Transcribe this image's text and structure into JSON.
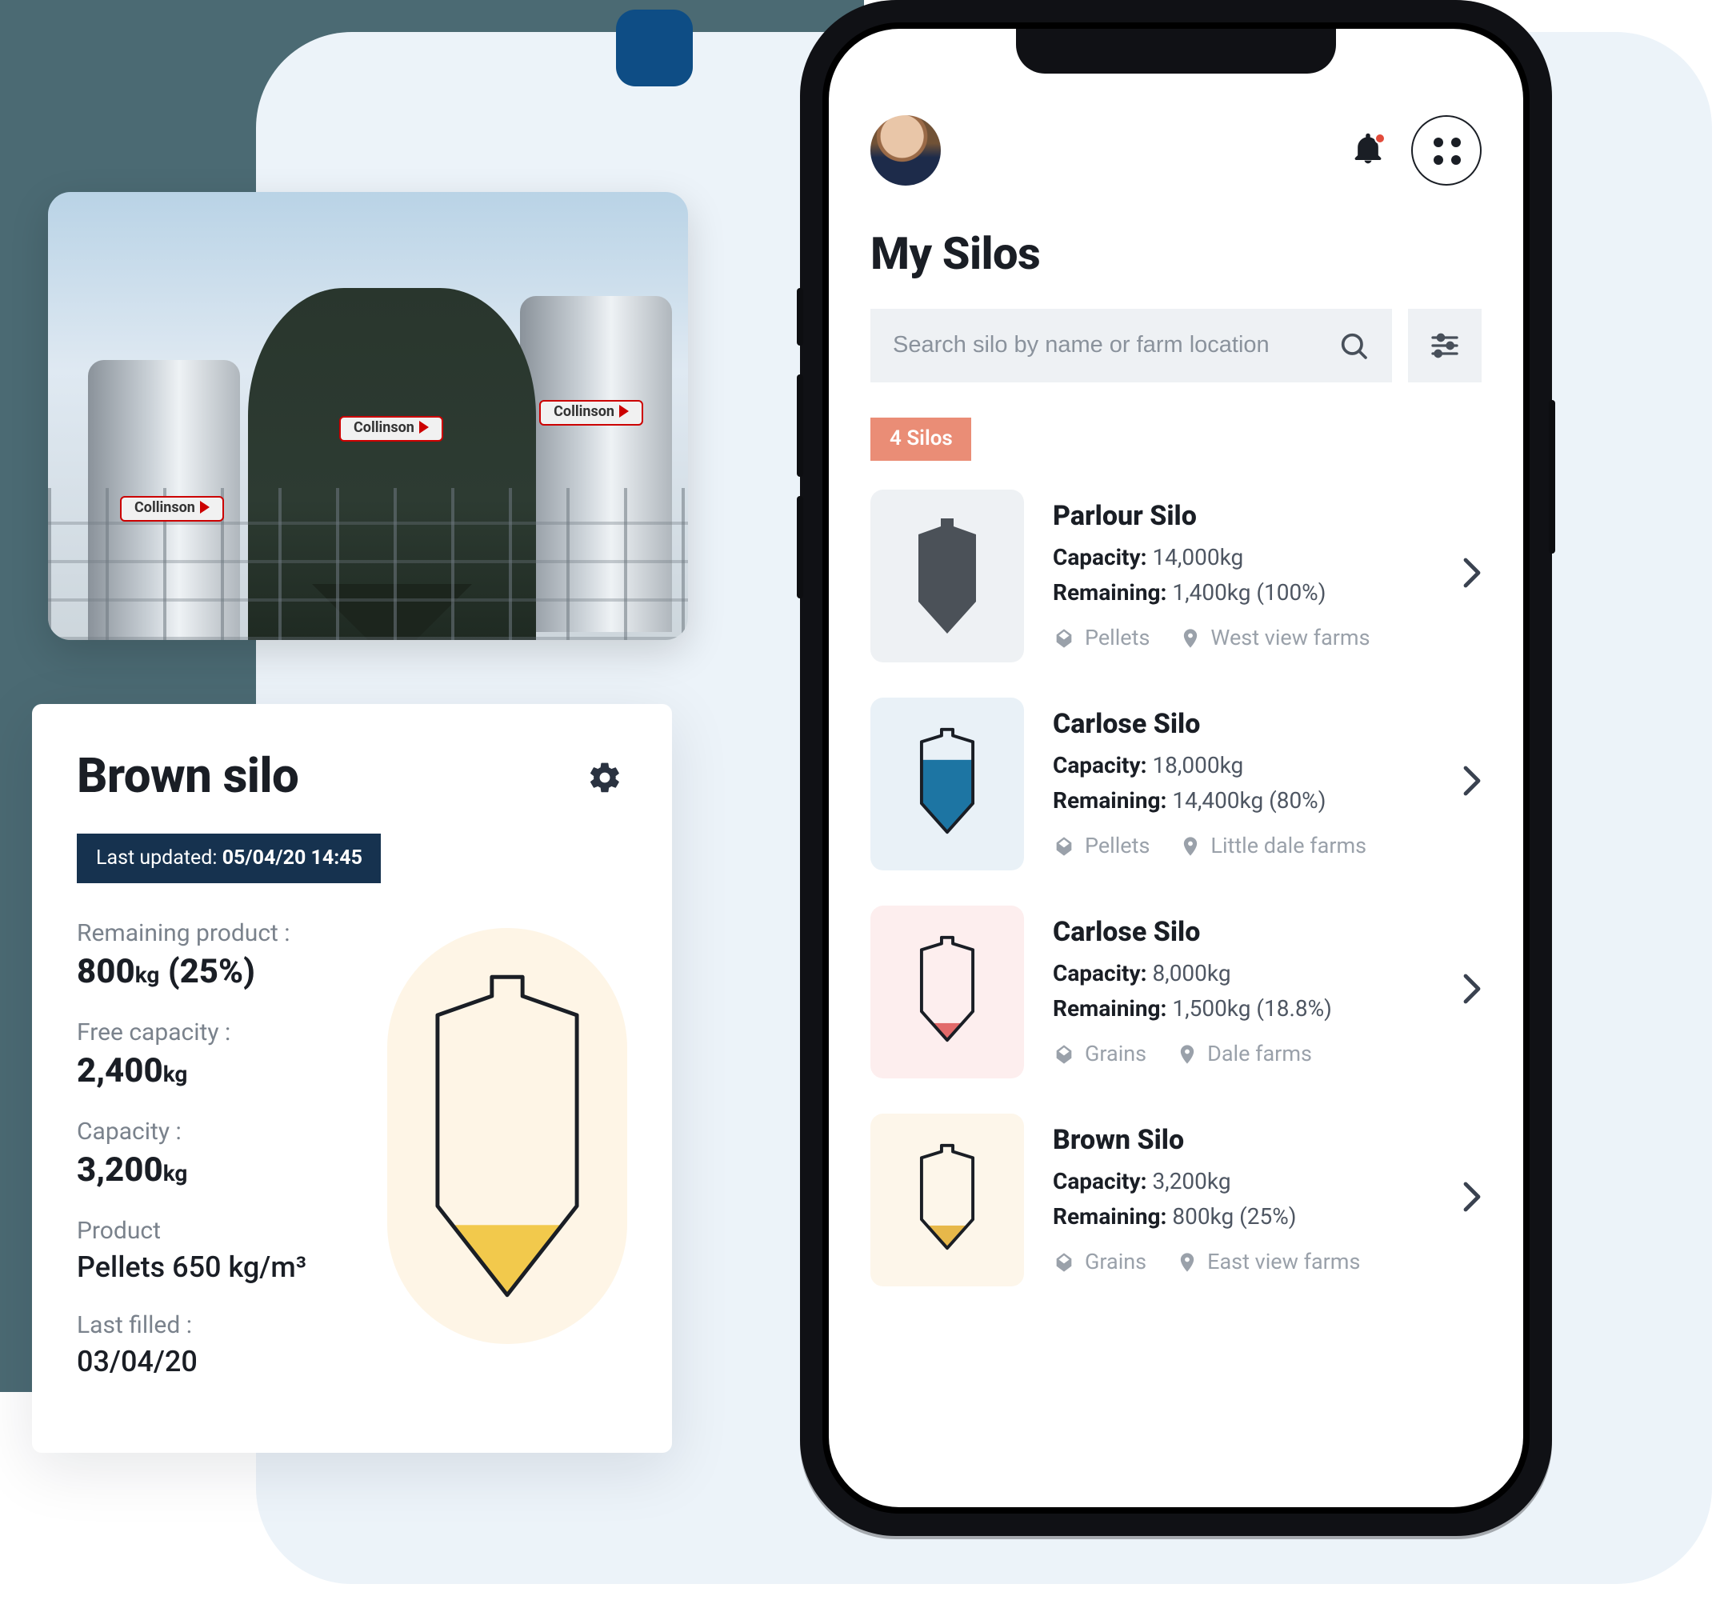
{
  "photo": {
    "brand_label": "Collinson"
  },
  "detail": {
    "title": "Brown silo",
    "last_updated_label": "Last updated:",
    "last_updated_value": "05/04/20 14:45",
    "kv": {
      "remaining_label": "Remaining product :",
      "remaining_value": "800",
      "remaining_unit": "kg",
      "remaining_pct": "(25%)",
      "free_label": "Free capacity :",
      "free_value": "2,400",
      "free_unit": "kg",
      "capacity_label": "Capacity :",
      "capacity_value": "3,200",
      "capacity_unit": "kg",
      "product_label": "Product",
      "product_value": "Pellets 650 kg/m³",
      "last_filled_label": "Last filled :",
      "last_filled_value": "03/04/20"
    },
    "fill": {
      "pct": 25,
      "color_top": "#f2c94c",
      "color_bottom": "#e0a93c"
    }
  },
  "phone": {
    "page_title": "My Silos",
    "search_placeholder": "Search silo by name or farm location",
    "count_badge": "4 Silos",
    "labels": {
      "capacity": "Capacity:",
      "remaining": "Remaining:"
    },
    "silos": [
      {
        "name": "Parlour Silo",
        "capacity": "14,000kg",
        "remaining": "1,400kg (100%)",
        "product": "Pellets",
        "location": "West view farms",
        "thumb_variant": "parlour",
        "fill_pct": 100,
        "fill_color": "#4b5158"
      },
      {
        "name": "Carlose Silo",
        "capacity": "18,000kg",
        "remaining": "14,400kg (80%)",
        "product": "Pellets",
        "location": "Little dale farms",
        "thumb_variant": "carlose1",
        "fill_pct": 80,
        "fill_color": "#1d75a3"
      },
      {
        "name": "Carlose Silo",
        "capacity": "8,000kg",
        "remaining": "1,500kg (18.8%)",
        "product": "Grains",
        "location": "Dale farms",
        "thumb_variant": "carlose2",
        "fill_pct": 18.8,
        "fill_color": "#e26a6a"
      },
      {
        "name": "Brown Silo",
        "capacity": "3,200kg",
        "remaining": "800kg (25%)",
        "product": "Grains",
        "location": "East view farms",
        "thumb_variant": "brown",
        "fill_pct": 25,
        "fill_color": "#e7b84a"
      }
    ]
  },
  "colors": {
    "teal": "#4b6a73",
    "panel": "#ecf3f9",
    "blue_square": "#0e4d85",
    "badge": "#ea8d76",
    "pill_navy": "#16324f"
  }
}
